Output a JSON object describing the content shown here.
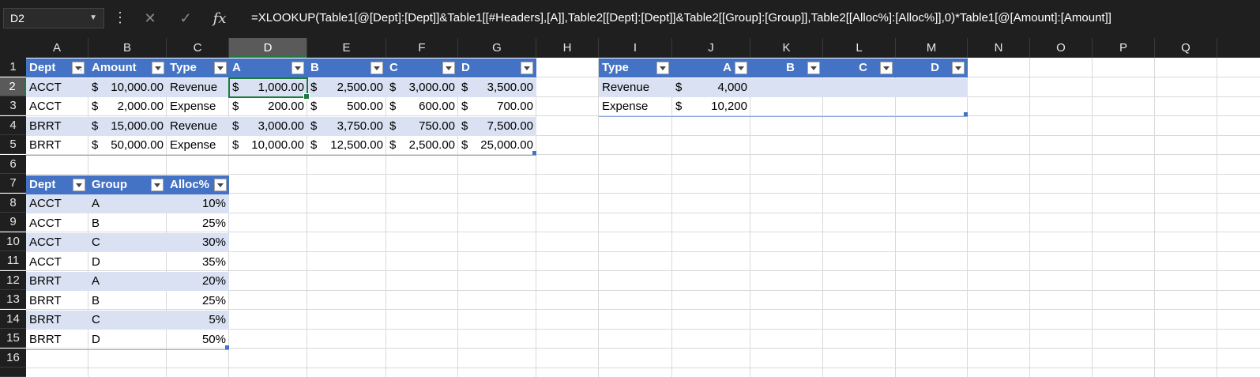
{
  "namebox": "D2",
  "formula": "=XLOOKUP(Table1[@[Dept]:[Dept]]&Table1[[#Headers],[A]],Table2[[Dept]:[Dept]]&Table2[[Group]:[Group]],Table2[[Alloc%]:[Alloc%]],0)*Table1[@[Amount]:[Amount]]",
  "toolbar": {
    "cancel_icon": "✕",
    "enter_icon": "✓",
    "fx_label": "fx"
  },
  "columns": [
    "A",
    "B",
    "C",
    "D",
    "E",
    "F",
    "G",
    "H",
    "I",
    "J",
    "K",
    "L",
    "M",
    "N",
    "O",
    "P",
    "Q"
  ],
  "rows": [
    "1",
    "2",
    "3",
    "4",
    "5",
    "6",
    "7",
    "8",
    "9",
    "10",
    "11",
    "12",
    "13",
    "14",
    "15",
    "16"
  ],
  "table1": {
    "headers": [
      "Dept",
      "Amount",
      "Type",
      "A",
      "B",
      "C",
      "D"
    ],
    "rows": [
      {
        "dept": "ACCT",
        "amount": "10,000.00",
        "type": "Revenue",
        "a": "1,000.00",
        "b": "2,500.00",
        "c": "3,000.00",
        "d": "3,500.00"
      },
      {
        "dept": "ACCT",
        "amount": "2,000.00",
        "type": "Expense",
        "a": "200.00",
        "b": "500.00",
        "c": "600.00",
        "d": "700.00"
      },
      {
        "dept": "BRRT",
        "amount": "15,000.00",
        "type": "Revenue",
        "a": "3,000.00",
        "b": "3,750.00",
        "c": "750.00",
        "d": "7,500.00"
      },
      {
        "dept": "BRRT",
        "amount": "50,000.00",
        "type": "Expense",
        "a": "10,000.00",
        "b": "12,500.00",
        "c": "2,500.00",
        "d": "25,000.00"
      }
    ]
  },
  "table2": {
    "headers": [
      "Dept",
      "Group",
      "Alloc%"
    ],
    "rows": [
      {
        "dept": "ACCT",
        "group": "A",
        "alloc": "10%"
      },
      {
        "dept": "ACCT",
        "group": "B",
        "alloc": "25%"
      },
      {
        "dept": "ACCT",
        "group": "C",
        "alloc": "30%"
      },
      {
        "dept": "ACCT",
        "group": "D",
        "alloc": "35%"
      },
      {
        "dept": "BRRT",
        "group": "A",
        "alloc": "20%"
      },
      {
        "dept": "BRRT",
        "group": "B",
        "alloc": "25%"
      },
      {
        "dept": "BRRT",
        "group": "C",
        "alloc": "5%"
      },
      {
        "dept": "BRRT",
        "group": "D",
        "alloc": "50%"
      }
    ]
  },
  "table3": {
    "headers": [
      "Type",
      "A",
      "B",
      "C",
      "D"
    ],
    "rows": [
      {
        "type": "Revenue",
        "a": "4,000"
      },
      {
        "type": "Expense",
        "a": "10,200"
      }
    ]
  },
  "currency_symbol": "$",
  "colors": {
    "header_blue": "#4472c4",
    "band_blue": "#d9e1f2",
    "active_green": "#1f7a3e",
    "chrome_dark": "#1f1f1f"
  }
}
